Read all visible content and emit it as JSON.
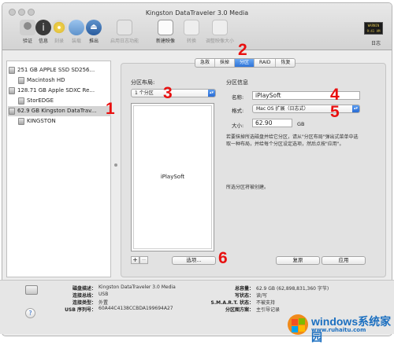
{
  "window": {
    "title": "Kingston DataTraveler 3.0 Media"
  },
  "toolbar": {
    "items": [
      {
        "label": "验证",
        "icon": "microscope-icon"
      },
      {
        "label": "信息",
        "icon": "info-icon"
      },
      {
        "label": "刻录",
        "icon": "burn-disc-icon"
      },
      {
        "label": "装载",
        "icon": "mount-icon"
      },
      {
        "label": "推出",
        "icon": "eject-icon"
      },
      {
        "label": "启用日志功能",
        "icon": "journal-icon"
      },
      {
        "label": "新建映像",
        "icon": "new-image-icon"
      },
      {
        "label": "转换",
        "icon": "convert-icon"
      },
      {
        "label": "调整映像大小",
        "icon": "resize-image-icon"
      }
    ],
    "log_label": "日志",
    "log_icon_text": [
      "WARNIN",
      "9:41 AM"
    ]
  },
  "sidebar": {
    "items": [
      {
        "label": "251 GB APPLE SSD SD256..."
      },
      {
        "label": "Macintosh HD"
      },
      {
        "label": "128.71 GB Apple SDXC Re..."
      },
      {
        "label": "StorEDGE"
      },
      {
        "label": "62.9 GB Kingston DataTrav..."
      },
      {
        "label": "KINGSTON"
      }
    ]
  },
  "tabs": [
    "急救",
    "抹掉",
    "分区",
    "RAID",
    "恢复"
  ],
  "partition": {
    "layout_label": "分区布局:",
    "layout_value": "1 个分区",
    "info_label": "分区信息",
    "name_label": "名称:",
    "name_value": "iPlaySoft",
    "format_label": "格式:",
    "format_value": "Mac OS 扩展（日志式）",
    "size_label": "大小:",
    "size_value": "62.90",
    "size_unit": "GB",
    "map_label": "iPlaySoft",
    "description": "若要抹掉所选磁盘并给它分区，请从\"分区布局\"弹出式菜单中选取一种布局，并给每个分区设定选项，然后点按\"应用\"。",
    "pending_text": "所选分区将被创建。",
    "add_label": "+",
    "remove_label": "−",
    "options_button": "选项...",
    "revert_button": "复原",
    "apply_button": "应用"
  },
  "disk_info": {
    "left": [
      {
        "key": "磁盘描述：",
        "value": "Kingston DataTraveler 3.0 Media"
      },
      {
        "key": "连接总线：",
        "value": "USB"
      },
      {
        "key": "连接类型：",
        "value": "外置"
      },
      {
        "key": "USB 序列号：",
        "value": "60A44C4138CCBDA199694A27"
      }
    ],
    "right": [
      {
        "key": "总容量：",
        "value": "62.9 GB (62,898,831,360 字节)"
      },
      {
        "key": "写状态：",
        "value": "读/写"
      },
      {
        "key": "S.M.A.R.T. 状态：",
        "value": "不被支持"
      },
      {
        "key": "分区图方案：",
        "value": "主引导记录"
      }
    ]
  },
  "help_label": "?",
  "annotations": [
    "1",
    "2",
    "3",
    "4",
    "5",
    "6"
  ],
  "watermark": {
    "title": "windows系统家园",
    "subtitle": "www.ruhaitu.com"
  },
  "colors": {
    "accent": "#2e74d8",
    "annotation": "#e81010"
  }
}
